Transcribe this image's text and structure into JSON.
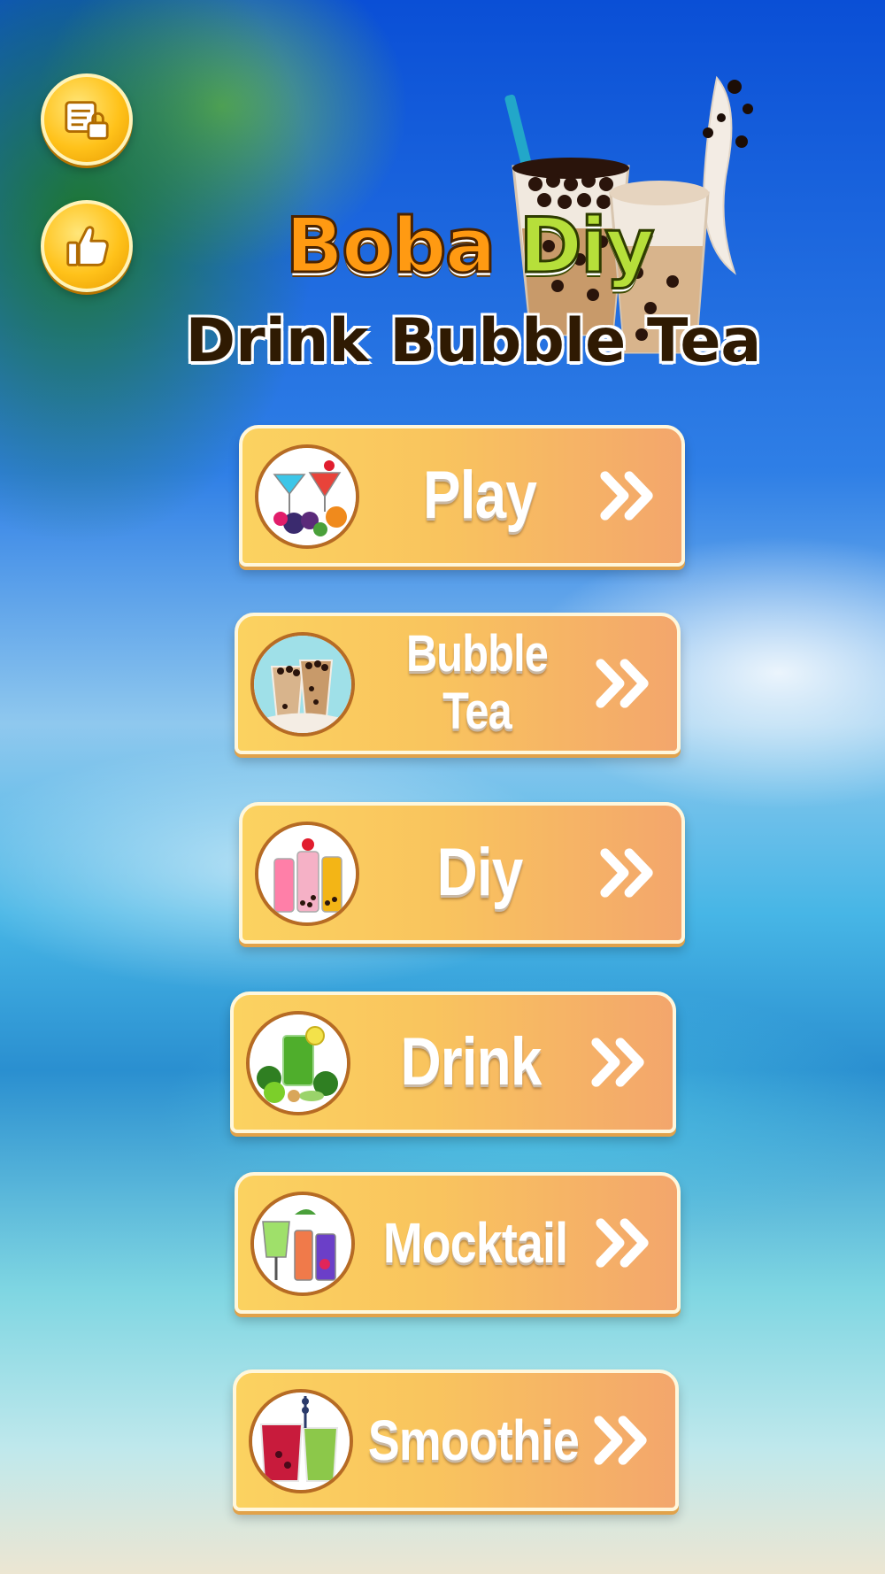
{
  "header": {
    "title_word1": "Boba",
    "title_word2": "Diy",
    "subtitle": "Drink Bubble Tea"
  },
  "side_buttons": [
    {
      "icon": "privacy-policy-icon"
    },
    {
      "icon": "thumbs-up-icon"
    }
  ],
  "menu": {
    "items": [
      {
        "label": "Play",
        "icon": "cocktail-fruit-icon"
      },
      {
        "label": "Bubble Tea",
        "icon": "bubble-tea-cups-icon"
      },
      {
        "label": "Diy",
        "icon": "three-drinks-icon"
      },
      {
        "label": "Drink",
        "icon": "green-juice-icon"
      },
      {
        "label": "Mocktail",
        "icon": "mocktail-glasses-icon"
      },
      {
        "label": "Smoothie",
        "icon": "smoothie-glasses-icon"
      }
    ],
    "chevron_icon": "double-chevron-right-icon"
  },
  "colors": {
    "button_left": "#fbd260",
    "button_right": "#f3a66c",
    "title_orange": "#ff9a12",
    "title_green": "#b6df3a",
    "subtitle_brown": "#2f1a02",
    "coin_gold": "#ffc21a"
  }
}
